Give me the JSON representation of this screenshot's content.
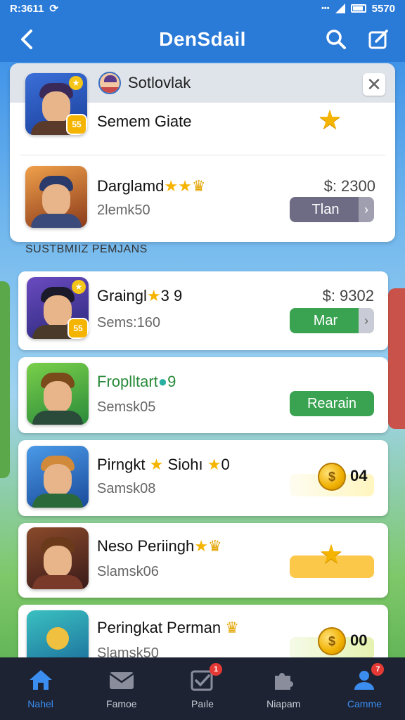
{
  "status_bar": {
    "left_text": "R:3611",
    "left_icon": "sync-icon",
    "right_text": "5570"
  },
  "header": {
    "title": "DenSdail"
  },
  "top_panel": {
    "header_name": "Sotlovlak",
    "rows": [
      {
        "title": "Semem Giate",
        "badge": "55"
      },
      {
        "title": "Darglamd",
        "subtitle": "2lemk50",
        "price": "$: 2300",
        "button": "Tlan"
      }
    ]
  },
  "section_label": "SUSTBMIIZ PEMJANS",
  "list": [
    {
      "title": "Graingl",
      "title_suffix": "3 9",
      "subtitle": "Sems:160",
      "badge": "55",
      "price": "$: 9302",
      "button": "Mar",
      "button_color": "#3aa351"
    },
    {
      "title": "Froplltart",
      "title_suffix": "9",
      "subtitle": "Semsk05",
      "button": "Rearain",
      "button_color": "#3aa351"
    },
    {
      "title": "Pirngkt",
      "title_suffix": "Siohı",
      "title_suffix2": "0",
      "subtitle": "Samsk08",
      "coin_value": "04"
    },
    {
      "title": "Neso Periingh",
      "subtitle": "Slamsk06"
    },
    {
      "title": "Peringkat Perman",
      "subtitle": "Slamsk50",
      "coin_value": "00"
    }
  ],
  "bottom_nav": [
    {
      "label": "Nahel",
      "icon": "home-icon",
      "active": true
    },
    {
      "label": "Famoe",
      "icon": "mail-icon"
    },
    {
      "label": "Paıle",
      "icon": "checkbox-icon",
      "badge": "1"
    },
    {
      "label": "Niapam",
      "icon": "puzzle-icon"
    },
    {
      "label": "Camme",
      "icon": "people-icon",
      "badge": "7"
    }
  ],
  "colors": {
    "accent": "#2a7ad8",
    "green": "#3aa351",
    "gold": "#f5b400",
    "nav_bg": "#1d2333"
  }
}
